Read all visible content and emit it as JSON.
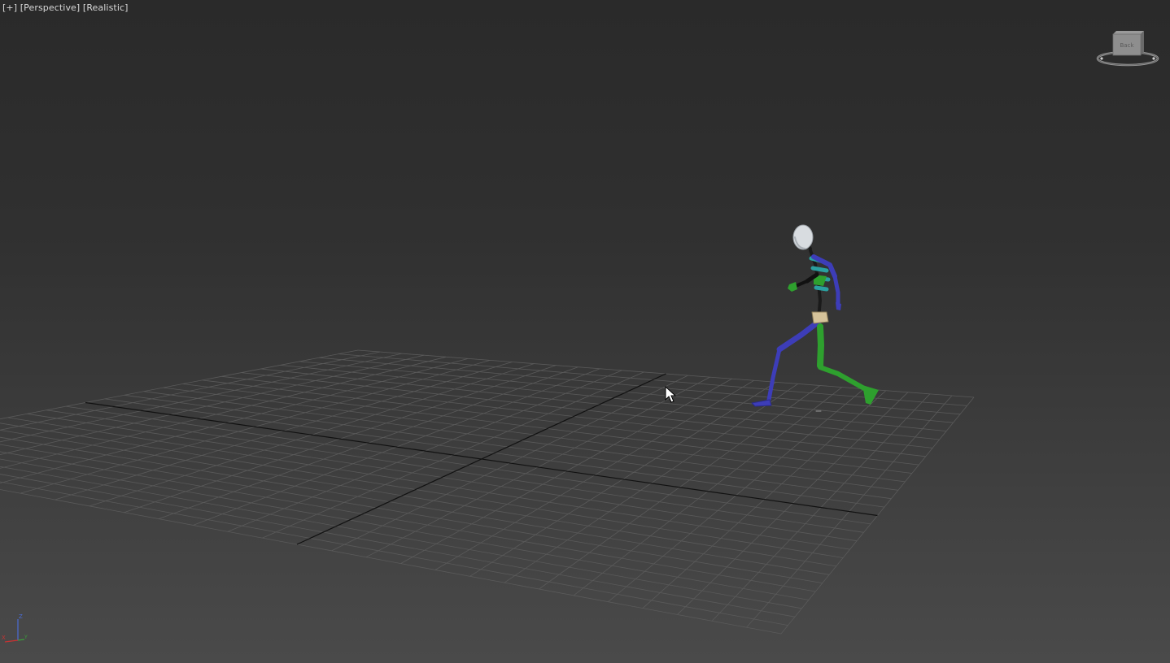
{
  "viewport": {
    "label_plus": "[+]",
    "label_view": "[Perspective]",
    "label_shading": "[Realistic]"
  },
  "viewcube": {
    "face_label": "Back",
    "icon": "viewcube-icon"
  },
  "axis_tripod": {
    "z_label": "Z",
    "x_label": "X",
    "y_label": "Y"
  },
  "colors": {
    "background_top": "#2a2a2a",
    "background_bottom": "#4a4a4a",
    "grid_line": "#5a5a5a",
    "grid_axis": "#111111",
    "biped_left": "#3d3db8",
    "biped_right": "#2ea02e",
    "biped_head": "#d8dce0",
    "biped_pelvis": "#d6c39a"
  },
  "cursor": {
    "icon": "mouse-pointer-icon"
  }
}
